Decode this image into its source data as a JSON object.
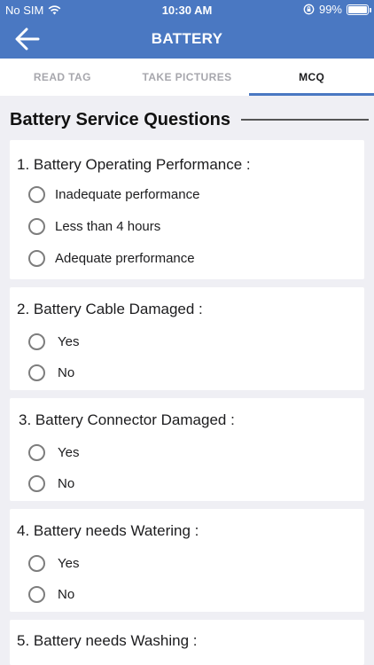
{
  "status_bar": {
    "carrier": "No SIM",
    "time": "10:30 AM",
    "battery": "99%"
  },
  "nav": {
    "title": "BATTERY"
  },
  "tabs": [
    {
      "label": "READ TAG"
    },
    {
      "label": "TAKE PICTURES"
    },
    {
      "label": "MCQ"
    }
  ],
  "active_tab": "MCQ",
  "section": {
    "title": "Battery Service Questions"
  },
  "questions": [
    {
      "label": "1. Battery Operating Performance :",
      "options": [
        "Inadequate performance",
        "Less than 4 hours",
        "Adequate prerformance"
      ]
    },
    {
      "label": "2. Battery Cable Damaged :",
      "options": [
        "Yes",
        "No"
      ]
    },
    {
      "label": "3. Battery Connector Damaged :",
      "options": [
        "Yes",
        "No"
      ]
    },
    {
      "label": "4. Battery needs Watering :",
      "options": [
        "Yes",
        "No"
      ]
    },
    {
      "label": "5. Battery needs Washing :",
      "options": []
    }
  ],
  "colors": {
    "accent": "#4a78c2",
    "background": "#efeff4",
    "card": "#ffffff"
  },
  "icons": {
    "back": "arrow-left-icon",
    "wifi": "wifi-icon",
    "rotation_lock": "rotation-lock-icon",
    "battery": "battery-icon"
  }
}
